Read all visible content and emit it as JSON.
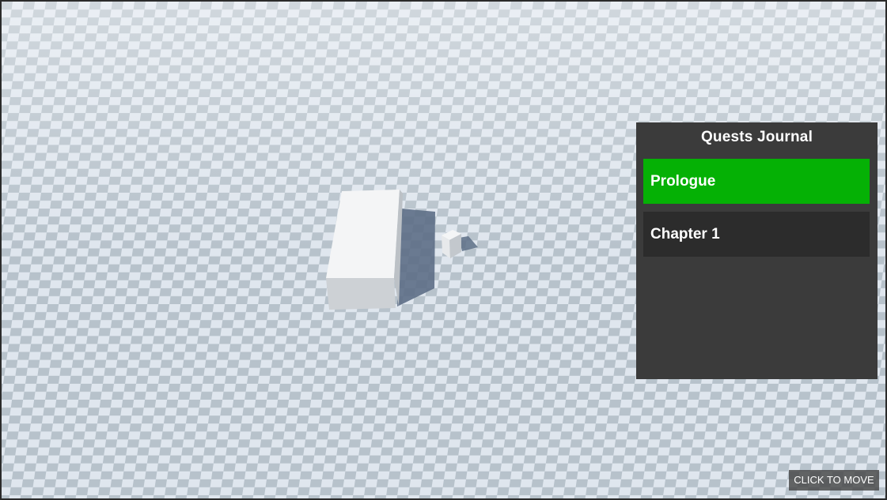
{
  "quest_journal": {
    "title": "Quests Journal",
    "items": [
      {
        "label": "Prologue",
        "selected": true
      },
      {
        "label": "Chapter 1",
        "selected": false
      }
    ],
    "selected_color": "#05b105",
    "item_color": "#2c2c2c",
    "panel_color": "#3b3b3b"
  },
  "hint": {
    "label": "CLICK TO MOVE"
  },
  "scene": {
    "floor_light": "#dfe6ee",
    "floor_dark": "#b4bfc8",
    "objects": [
      "large-white-box",
      "small-white-cube"
    ]
  }
}
